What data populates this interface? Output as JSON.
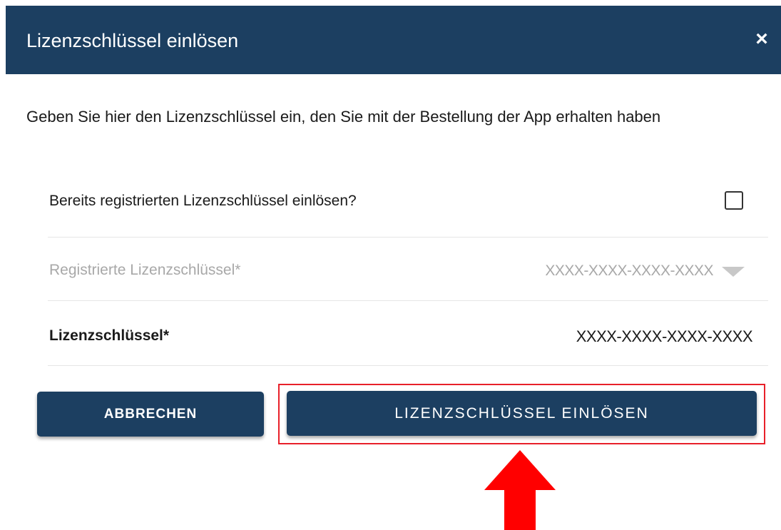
{
  "dialog": {
    "title": "Lizenzschlüssel einlösen",
    "close_label": "×",
    "description": "Geben Sie hier den Lizenzschlüssel ein, den Sie mit der Bestellung der App erhalten haben"
  },
  "form": {
    "registered_question": "Bereits registrierten Lizenzschlüssel einlösen?",
    "registered_checked": false,
    "registered_keys_label": "Registrierte Lizenzschlüssel*",
    "registered_keys_value": "XXXX-XXXX-XXXX-XXXX",
    "license_key_label": "Lizenzschlüssel*",
    "license_key_value": "XXXX-XXXX-XXXX-XXXX"
  },
  "buttons": {
    "cancel_label": "ABBRECHEN",
    "redeem_label": "LIZENZSCHLÜSSEL EINLÖSEN"
  },
  "colors": {
    "primary": "#1c3f61",
    "highlight": "#e8202a",
    "arrow": "#ff0000"
  }
}
